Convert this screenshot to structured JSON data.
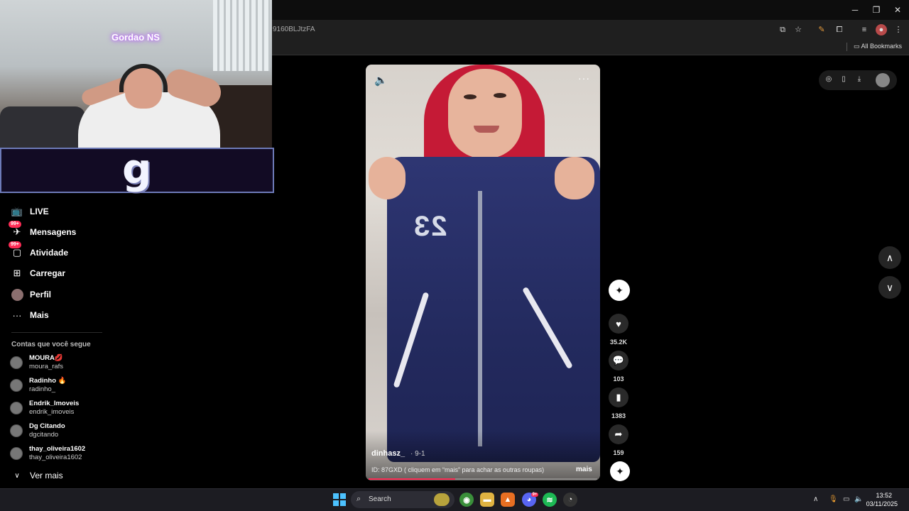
{
  "browser": {
    "url_fragment": "9160BLJtzFA",
    "bookmarks_label": "All Bookmarks",
    "controls": {
      "minimize": "─",
      "restore": "❐",
      "close": "✕"
    }
  },
  "stream": {
    "webcam_name": "Gordao NS",
    "logo_letter": "g"
  },
  "sidebar": {
    "items": [
      {
        "label": "LIVE",
        "icon": "live-tv-icon"
      },
      {
        "label": "Mensagens",
        "icon": "messages-icon",
        "badge": "99+"
      },
      {
        "label": "Atividade",
        "icon": "activity-icon",
        "badge": "99+"
      },
      {
        "label": "Carregar",
        "icon": "upload-icon"
      },
      {
        "label": "Perfil",
        "icon": "profile-avatar-icon"
      },
      {
        "label": "Mais",
        "icon": "more-dots-icon"
      }
    ],
    "following_title": "Contas que você segue",
    "accounts": [
      {
        "name": "MOURA💋",
        "user": "moura_rafs"
      },
      {
        "name": "Radinho 🔥",
        "user": "radinho_"
      },
      {
        "name": "Endrik_Imoveis",
        "user": "endrik_imoveis"
      },
      {
        "name": "Dg Citando",
        "user": "dgcitando"
      },
      {
        "name": "thay_oliveira1602",
        "user": "thay_oliveira1602"
      }
    ],
    "see_more": "Ver mais"
  },
  "video": {
    "author": "dinhasz_",
    "date": "· 9-1",
    "caption": "ID: 87GXD ( cliquem em “mais” para achar as outras roupas)",
    "more_label": "mais",
    "progress": 0.38,
    "shirt_number": "23"
  },
  "actions": {
    "likes": "35.2K",
    "comments": "103",
    "saves": "1383",
    "shares": "159"
  },
  "taskbar": {
    "search_placeholder": "Search",
    "time": "13:52",
    "date": "03/11/2025",
    "discord_badge": "9+"
  },
  "colors": {
    "accent": "#fe2c55",
    "background": "#000000",
    "start_blue": "#4cc2ff"
  }
}
